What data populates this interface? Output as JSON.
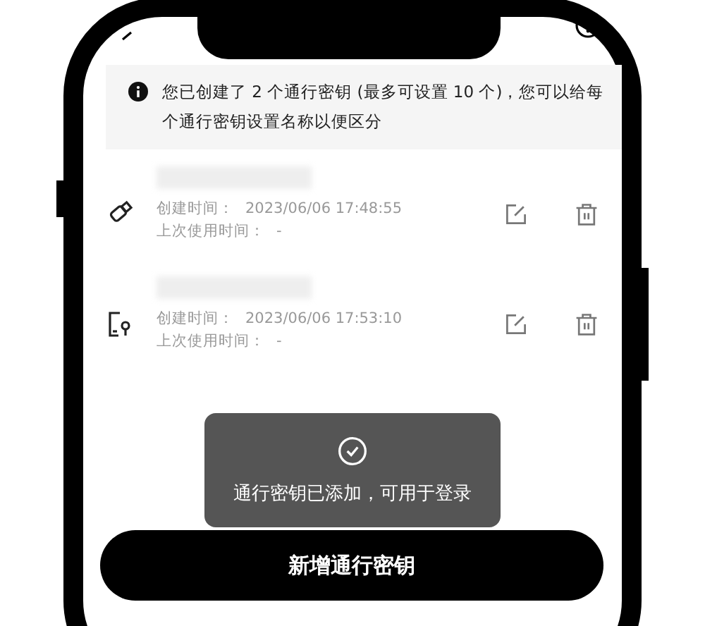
{
  "banner": {
    "text": "您已创建了 2 个通行密钥 (最多可设置 10 个)，您可以给每个通行密钥设置名称以便区分"
  },
  "passkeys": [
    {
      "kind": "usb",
      "created_label": "创建时间：",
      "created": "2023/06/06 17:48:55",
      "last_used_label": "上次使用时间：",
      "last_used": "-"
    },
    {
      "kind": "phone",
      "created_label": "创建时间：",
      "created": "2023/06/06 17:53:10",
      "last_used_label": "上次使用时间：",
      "last_used": "-"
    }
  ],
  "toast": {
    "text": "通行密钥已添加，可用于登录"
  },
  "add_button": "新增通行密钥"
}
